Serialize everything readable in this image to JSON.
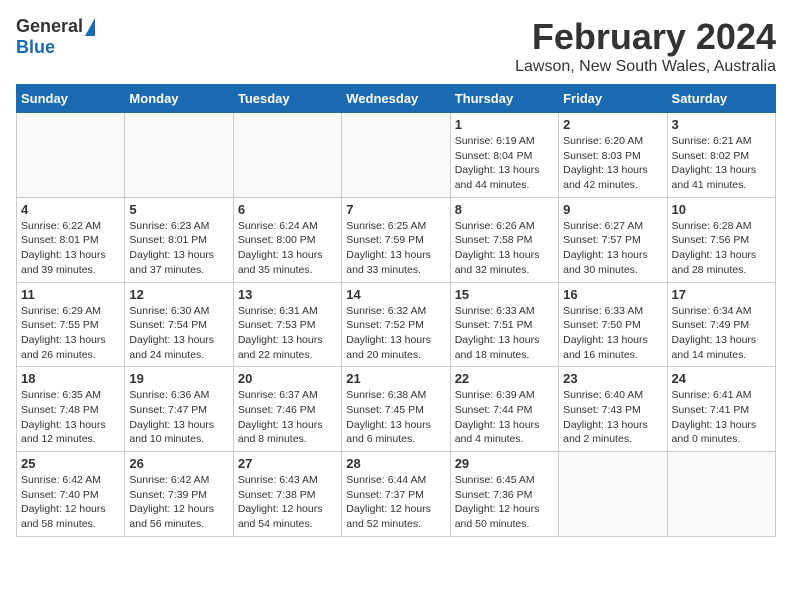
{
  "header": {
    "logo_general": "General",
    "logo_blue": "Blue",
    "month_title": "February 2024",
    "location": "Lawson, New South Wales, Australia"
  },
  "days_of_week": [
    "Sunday",
    "Monday",
    "Tuesday",
    "Wednesday",
    "Thursday",
    "Friday",
    "Saturday"
  ],
  "weeks": [
    [
      {
        "day": "",
        "info": ""
      },
      {
        "day": "",
        "info": ""
      },
      {
        "day": "",
        "info": ""
      },
      {
        "day": "",
        "info": ""
      },
      {
        "day": "1",
        "info": "Sunrise: 6:19 AM\nSunset: 8:04 PM\nDaylight: 13 hours\nand 44 minutes."
      },
      {
        "day": "2",
        "info": "Sunrise: 6:20 AM\nSunset: 8:03 PM\nDaylight: 13 hours\nand 42 minutes."
      },
      {
        "day": "3",
        "info": "Sunrise: 6:21 AM\nSunset: 8:02 PM\nDaylight: 13 hours\nand 41 minutes."
      }
    ],
    [
      {
        "day": "4",
        "info": "Sunrise: 6:22 AM\nSunset: 8:01 PM\nDaylight: 13 hours\nand 39 minutes."
      },
      {
        "day": "5",
        "info": "Sunrise: 6:23 AM\nSunset: 8:01 PM\nDaylight: 13 hours\nand 37 minutes."
      },
      {
        "day": "6",
        "info": "Sunrise: 6:24 AM\nSunset: 8:00 PM\nDaylight: 13 hours\nand 35 minutes."
      },
      {
        "day": "7",
        "info": "Sunrise: 6:25 AM\nSunset: 7:59 PM\nDaylight: 13 hours\nand 33 minutes."
      },
      {
        "day": "8",
        "info": "Sunrise: 6:26 AM\nSunset: 7:58 PM\nDaylight: 13 hours\nand 32 minutes."
      },
      {
        "day": "9",
        "info": "Sunrise: 6:27 AM\nSunset: 7:57 PM\nDaylight: 13 hours\nand 30 minutes."
      },
      {
        "day": "10",
        "info": "Sunrise: 6:28 AM\nSunset: 7:56 PM\nDaylight: 13 hours\nand 28 minutes."
      }
    ],
    [
      {
        "day": "11",
        "info": "Sunrise: 6:29 AM\nSunset: 7:55 PM\nDaylight: 13 hours\nand 26 minutes."
      },
      {
        "day": "12",
        "info": "Sunrise: 6:30 AM\nSunset: 7:54 PM\nDaylight: 13 hours\nand 24 minutes."
      },
      {
        "day": "13",
        "info": "Sunrise: 6:31 AM\nSunset: 7:53 PM\nDaylight: 13 hours\nand 22 minutes."
      },
      {
        "day": "14",
        "info": "Sunrise: 6:32 AM\nSunset: 7:52 PM\nDaylight: 13 hours\nand 20 minutes."
      },
      {
        "day": "15",
        "info": "Sunrise: 6:33 AM\nSunset: 7:51 PM\nDaylight: 13 hours\nand 18 minutes."
      },
      {
        "day": "16",
        "info": "Sunrise: 6:33 AM\nSunset: 7:50 PM\nDaylight: 13 hours\nand 16 minutes."
      },
      {
        "day": "17",
        "info": "Sunrise: 6:34 AM\nSunset: 7:49 PM\nDaylight: 13 hours\nand 14 minutes."
      }
    ],
    [
      {
        "day": "18",
        "info": "Sunrise: 6:35 AM\nSunset: 7:48 PM\nDaylight: 13 hours\nand 12 minutes."
      },
      {
        "day": "19",
        "info": "Sunrise: 6:36 AM\nSunset: 7:47 PM\nDaylight: 13 hours\nand 10 minutes."
      },
      {
        "day": "20",
        "info": "Sunrise: 6:37 AM\nSunset: 7:46 PM\nDaylight: 13 hours\nand 8 minutes."
      },
      {
        "day": "21",
        "info": "Sunrise: 6:38 AM\nSunset: 7:45 PM\nDaylight: 13 hours\nand 6 minutes."
      },
      {
        "day": "22",
        "info": "Sunrise: 6:39 AM\nSunset: 7:44 PM\nDaylight: 13 hours\nand 4 minutes."
      },
      {
        "day": "23",
        "info": "Sunrise: 6:40 AM\nSunset: 7:43 PM\nDaylight: 13 hours\nand 2 minutes."
      },
      {
        "day": "24",
        "info": "Sunrise: 6:41 AM\nSunset: 7:41 PM\nDaylight: 13 hours\nand 0 minutes."
      }
    ],
    [
      {
        "day": "25",
        "info": "Sunrise: 6:42 AM\nSunset: 7:40 PM\nDaylight: 12 hours\nand 58 minutes."
      },
      {
        "day": "26",
        "info": "Sunrise: 6:42 AM\nSunset: 7:39 PM\nDaylight: 12 hours\nand 56 minutes."
      },
      {
        "day": "27",
        "info": "Sunrise: 6:43 AM\nSunset: 7:38 PM\nDaylight: 12 hours\nand 54 minutes."
      },
      {
        "day": "28",
        "info": "Sunrise: 6:44 AM\nSunset: 7:37 PM\nDaylight: 12 hours\nand 52 minutes."
      },
      {
        "day": "29",
        "info": "Sunrise: 6:45 AM\nSunset: 7:36 PM\nDaylight: 12 hours\nand 50 minutes."
      },
      {
        "day": "",
        "info": ""
      },
      {
        "day": "",
        "info": ""
      }
    ]
  ]
}
